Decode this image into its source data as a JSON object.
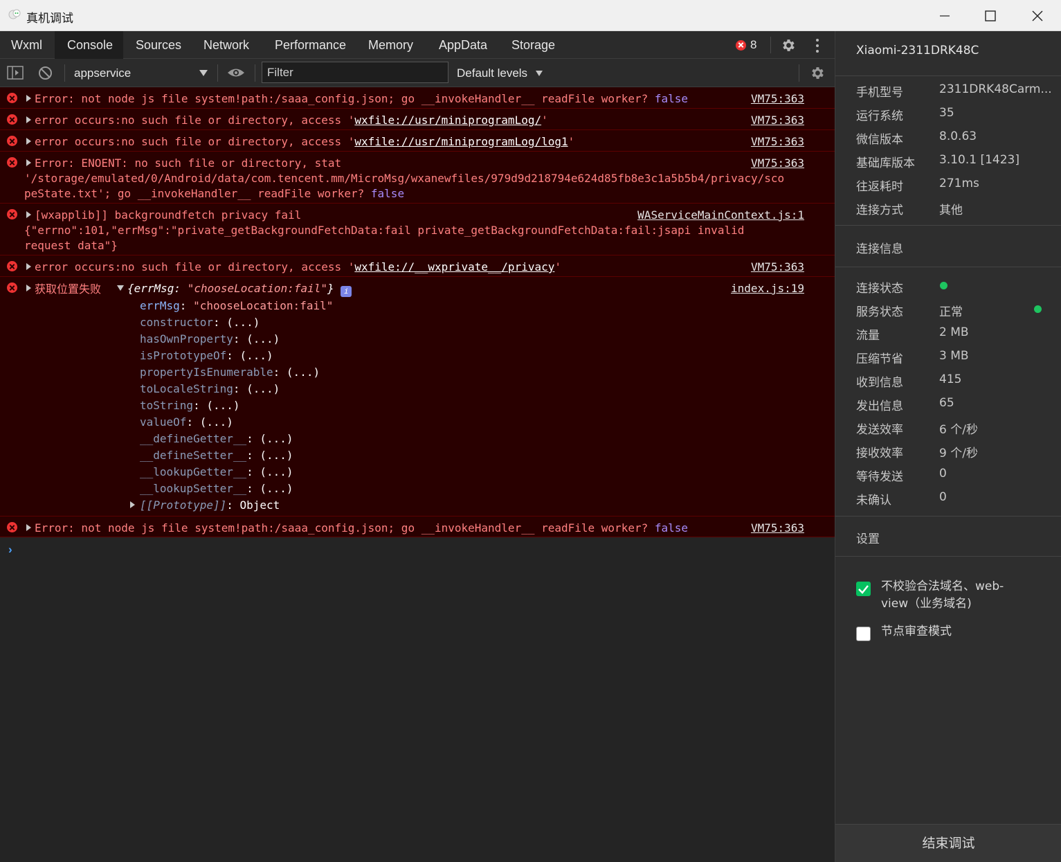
{
  "window": {
    "title": "真机调试"
  },
  "tabs": [
    {
      "label": "Wxml"
    },
    {
      "label": "Console"
    },
    {
      "label": "Sources"
    },
    {
      "label": "Network"
    },
    {
      "label": "Performance"
    },
    {
      "label": "Memory"
    },
    {
      "label": "AppData"
    },
    {
      "label": "Storage"
    }
  ],
  "error_count": "8",
  "toolbar": {
    "context": "appservice",
    "filter_placeholder": "Filter",
    "levels": "Default levels"
  },
  "console": {
    "rows": [
      {
        "msg_a": "Error: not node js file system!path:/saaa_config.json; go __invokeHandler__ readFile worker? ",
        "msg_b": "false",
        "src": "VM75:363"
      },
      {
        "msg_a": "error occurs:no such file or directory, access '",
        "link": "wxfile://usr/miniprogramLog/",
        "msg_b": "'",
        "src": "VM75:363"
      },
      {
        "msg_a": "error occurs:no such file or directory, access '",
        "link": "wxfile://usr/miniprogramLog/log1",
        "msg_b": "'",
        "src": "VM75:363"
      },
      {
        "msg_a": "Error: ENOENT: no such file or directory, stat",
        "line2": "'/storage/emulated/0/Android/data/com.tencent.mm/MicroMsg/wxanewfiles/979d9d218794e624d85fb8e3c1a5b5b4/privacy/sco",
        "line3": "peState.txt'; go __invokeHandler__ readFile worker? ",
        "line3b": "false",
        "src": "VM75:363"
      },
      {
        "msg_a": "[wxapplib]] backgroundfetch privacy fail",
        "line2": "{\"errno\":101,\"errMsg\":\"private_getBackgroundFetchData:fail private_getBackgroundFetchData:fail:jsapi invalid",
        "line3": "request data\"}",
        "src": "WAServiceMainContext.js:1"
      },
      {
        "msg_a": "error occurs:no such file or directory, access '",
        "link": "wxfile://__wxprivate__/privacy",
        "msg_b": "'",
        "src": "VM75:363"
      },
      {
        "msg_a": "获取位置失败",
        "obj_head": "{errMsg: ",
        "obj_val": "\"chooseLocation:fail\"",
        "obj_tail": "}",
        "src": "index.js:19",
        "props": [
          {
            "k": "errMsg",
            "v": "\"chooseLocation:fail\""
          },
          {
            "k": "constructor",
            "v": "(...)"
          },
          {
            "k": "hasOwnProperty",
            "v": "(...)"
          },
          {
            "k": "isPrototypeOf",
            "v": "(...)"
          },
          {
            "k": "propertyIsEnumerable",
            "v": "(...)"
          },
          {
            "k": "toLocaleString",
            "v": "(...)"
          },
          {
            "k": "toString",
            "v": "(...)"
          },
          {
            "k": "valueOf",
            "v": "(...)"
          },
          {
            "k": "__defineGetter__",
            "v": "(...)"
          },
          {
            "k": "__defineSetter__",
            "v": "(...)"
          },
          {
            "k": "__lookupGetter__",
            "v": "(...)"
          },
          {
            "k": "__lookupSetter__",
            "v": "(...)"
          },
          {
            "k": "[[Prototype]]",
            "v": "Object"
          }
        ]
      },
      {
        "msg_a": "Error: not node js file system!path:/saaa_config.json; go __invokeHandler__ readFile worker? ",
        "msg_b": "false",
        "src": "VM75:363"
      }
    ],
    "prompt": "›"
  },
  "panel": {
    "device": "Xiaomi-2311DRK48C",
    "info": [
      {
        "label": "手机型号",
        "value": "2311DRK48Carm..."
      },
      {
        "label": "运行系统",
        "value": "35"
      },
      {
        "label": "微信版本",
        "value": "8.0.63"
      },
      {
        "label": "基础库版本",
        "value": "3.10.1 [1423]"
      },
      {
        "label": "往返耗时",
        "value": "271ms"
      },
      {
        "label": "连接方式",
        "value": "其他"
      }
    ],
    "conn_title": "连接信息",
    "conn": [
      {
        "label": "连接状态",
        "value": ""
      },
      {
        "label": "服务状态",
        "value": "正常"
      },
      {
        "label": "流量",
        "value": "2 MB"
      },
      {
        "label": "压缩节省",
        "value": "3 MB"
      },
      {
        "label": "收到信息",
        "value": "415"
      },
      {
        "label": "发出信息",
        "value": "65"
      },
      {
        "label": "发送效率",
        "value": "6 个/秒"
      },
      {
        "label": "接收效率",
        "value": "9 个/秒"
      },
      {
        "label": "等待发送",
        "value": "0"
      },
      {
        "label": "未确认",
        "value": "0"
      }
    ],
    "settings_title": "设置",
    "settings": [
      {
        "label_1": "不校验合法域名、web-",
        "label_2": "view（业务域名)",
        "checked": true
      },
      {
        "label_1": "节点审查模式",
        "checked": false
      }
    ],
    "end_button": "结束调试"
  },
  "colors": {
    "error_bg": "#290000",
    "error_text": "#ff8080",
    "accent_green": "#07c160"
  }
}
